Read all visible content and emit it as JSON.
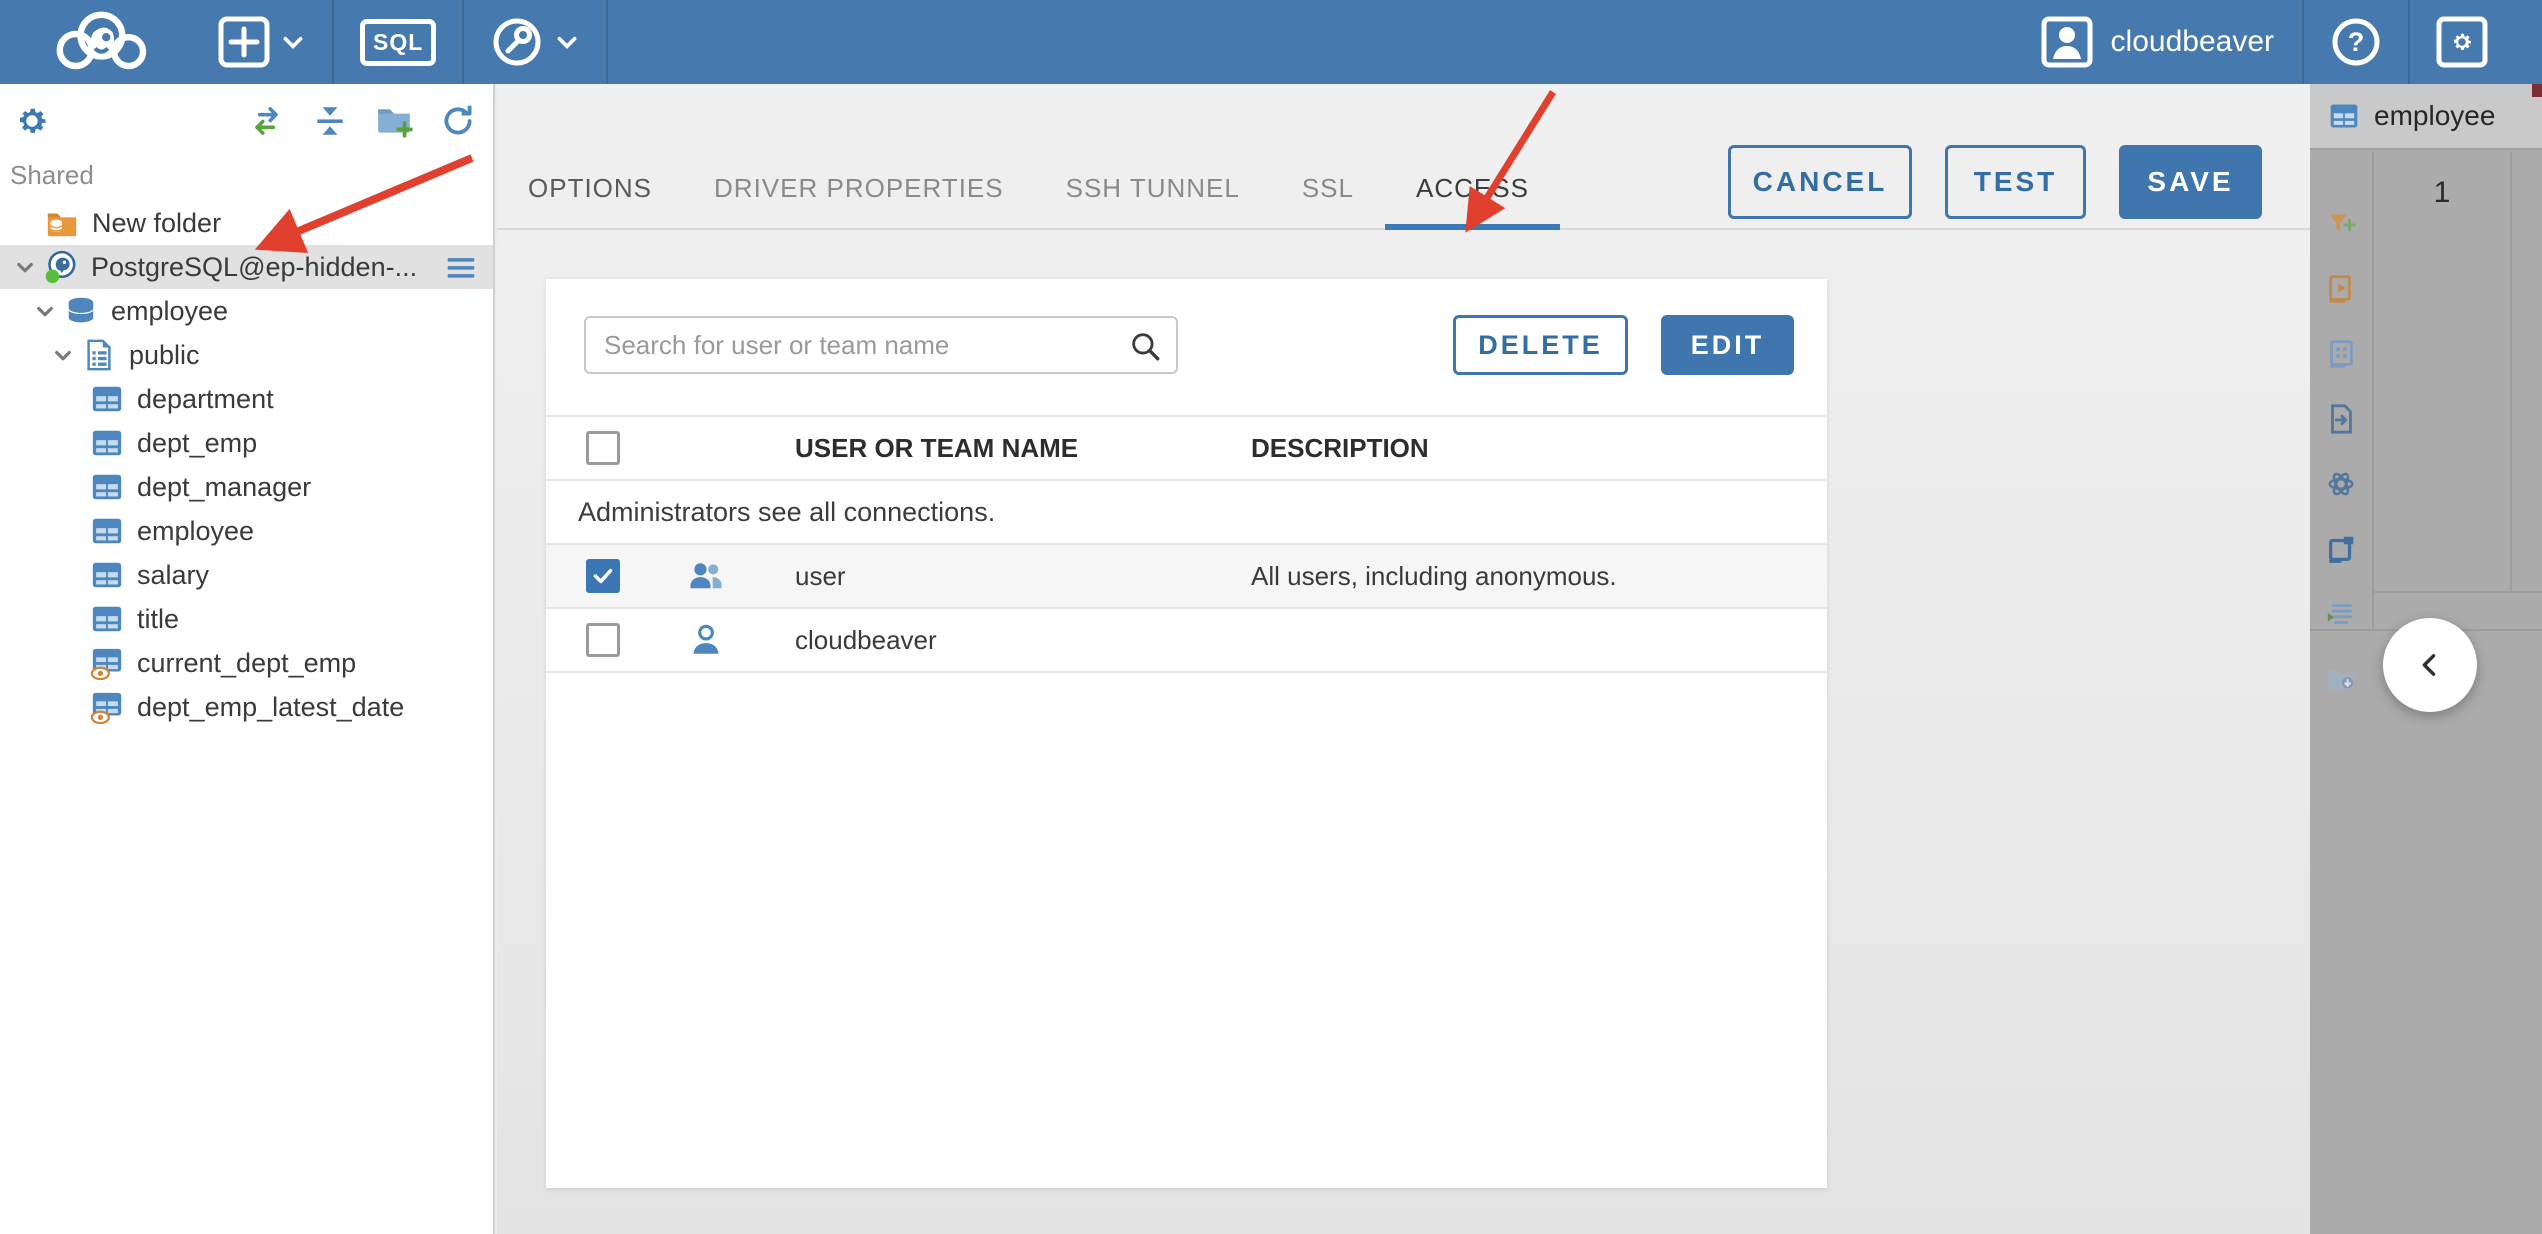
{
  "header": {
    "username": "cloudbeaver",
    "sql_label": "SQL"
  },
  "sidebar": {
    "section_label": "Shared",
    "tree": [
      {
        "label": "New folder",
        "type": "folder"
      },
      {
        "label": "PostgreSQL@ep-hidden-...",
        "type": "postgresql",
        "selected": true
      },
      {
        "label": "employee",
        "type": "database"
      },
      {
        "label": "public",
        "type": "schema"
      },
      {
        "label": "department",
        "type": "table"
      },
      {
        "label": "dept_emp",
        "type": "table"
      },
      {
        "label": "dept_manager",
        "type": "table"
      },
      {
        "label": "employee",
        "type": "table"
      },
      {
        "label": "salary",
        "type": "table"
      },
      {
        "label": "title",
        "type": "table"
      },
      {
        "label": "current_dept_emp",
        "type": "view"
      },
      {
        "label": "dept_emp_latest_date",
        "type": "view"
      }
    ]
  },
  "main": {
    "tabs": [
      {
        "label": "OPTIONS"
      },
      {
        "label": "DRIVER PROPERTIES"
      },
      {
        "label": "SSH TUNNEL"
      },
      {
        "label": "SSL"
      },
      {
        "label": "ACCESS",
        "active": true
      }
    ],
    "buttons": {
      "cancel": "CANCEL",
      "test": "TEST",
      "save": "SAVE"
    },
    "access": {
      "search_placeholder": "Search for user or team name",
      "delete_label": "DELETE",
      "edit_label": "EDIT",
      "columns": {
        "name": "USER OR TEAM NAME",
        "description": "DESCRIPTION"
      },
      "info_row": "Administrators see all connections.",
      "rows": [
        {
          "name": "user",
          "description": "All users, including anonymous.",
          "checked": true,
          "icon": "team"
        },
        {
          "name": "cloudbeaver",
          "description": "",
          "checked": false,
          "icon": "user"
        }
      ]
    }
  },
  "right_panel": {
    "tab_label": "employee",
    "row_number": "1"
  },
  "colors": {
    "topbar_blue": "#4679ad",
    "accent_blue": "#3e76ad",
    "tab_underline": "#3c79b8",
    "checkbox_checked": "#3b77b5",
    "status_green": "#55c03f",
    "annotation_red": "#e2402f",
    "selected_row_gray": "#e1e1e1",
    "right_panel_gray": "#ababab"
  }
}
